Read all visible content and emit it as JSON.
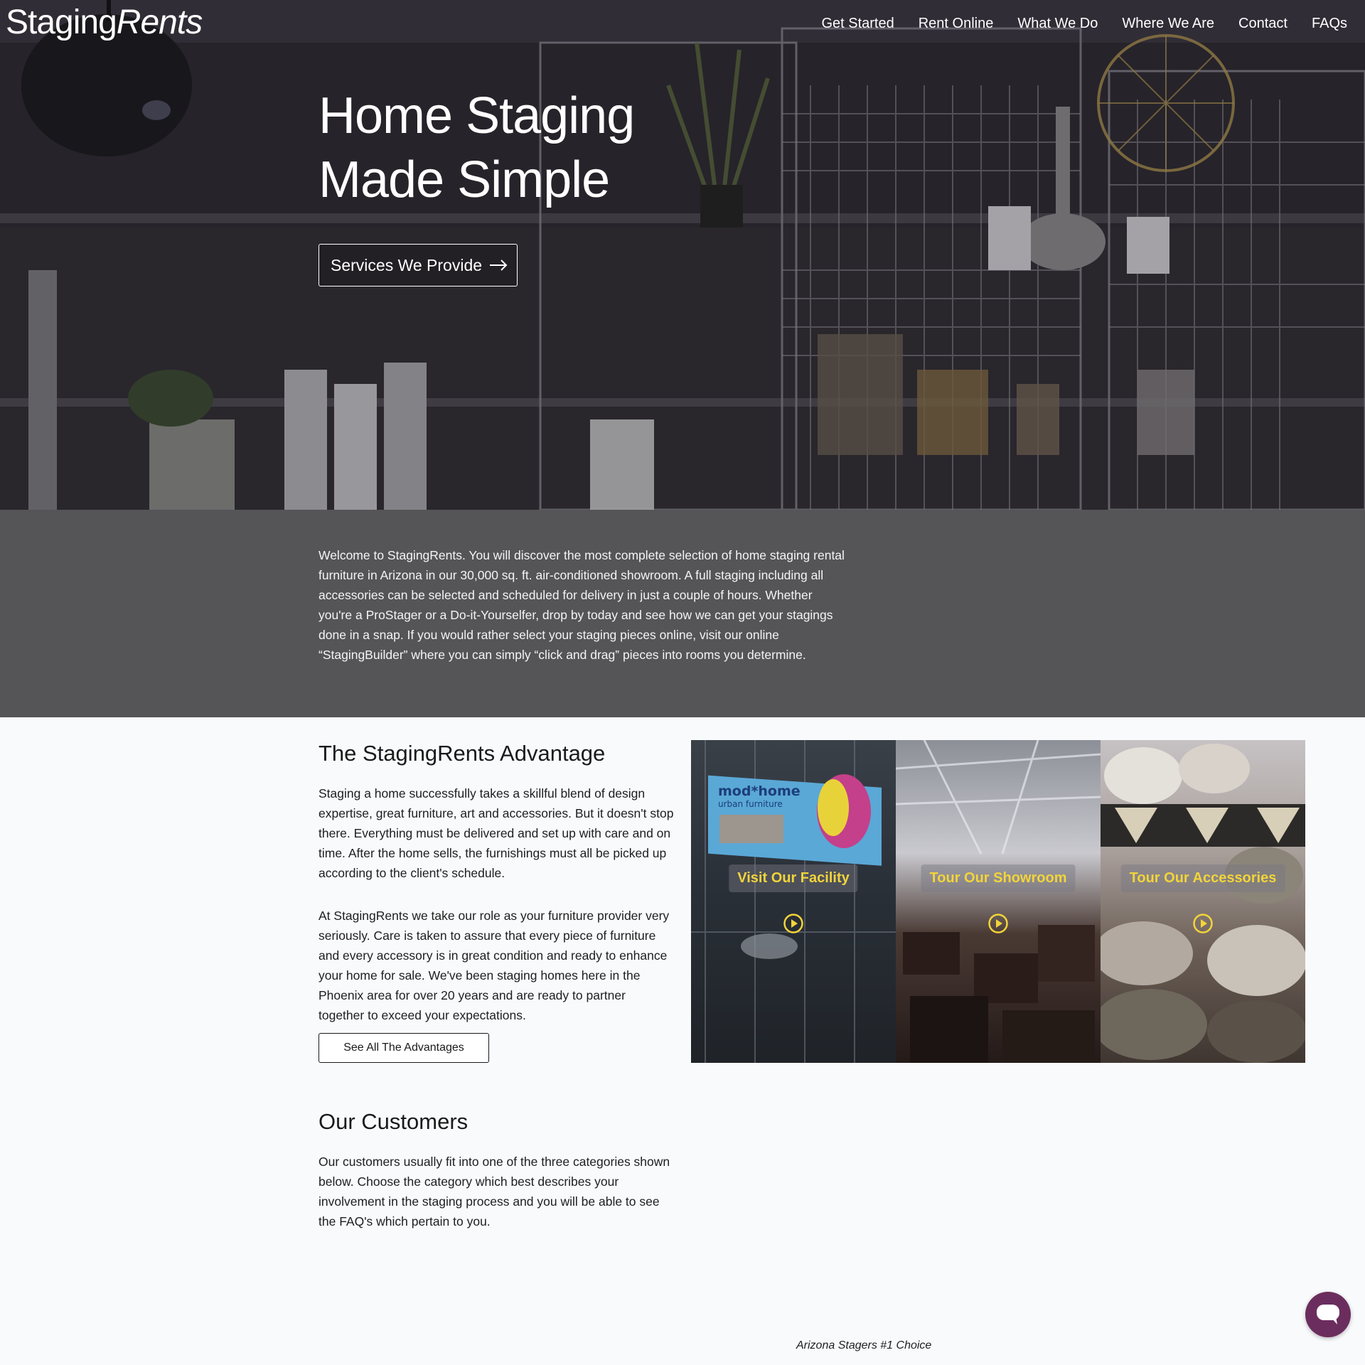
{
  "brand": {
    "logo_part1": "Staging",
    "logo_part2": "Rents"
  },
  "nav": {
    "items": [
      "Get Started",
      "Rent Online",
      "What We Do",
      "Where We Are",
      "Contact",
      "FAQs"
    ]
  },
  "hero": {
    "title_line1": "Home Staging",
    "title_line2": "Made Simple",
    "cta_label": "Services We Provide",
    "cta_icon": "arrow-right-icon"
  },
  "intro": {
    "text": "Welcome to StagingRents. You will discover the most complete selection of home staging rental furniture in Arizona in our 30,000 sq. ft. air-conditioned showroom. A full staging including all accessories can be selected and scheduled for delivery in just a couple of hours. Whether you're a ProStager or a Do-it-Yourselfer, drop by today and see how we can get your stagings done in a snap. If you would rather select your staging pieces online, visit our online “StagingBuilder” where you can simply “click and drag” pieces into rooms you determine."
  },
  "advantage": {
    "title": "The StagingRents Advantage",
    "p1": "Staging a home successfully takes a skillful blend of design expertise, great furniture, art and accessories. But it doesn't stop there. Everything must be delivered and set up with care and on time. After the home sells, the furnishings must all be picked up according to the client's schedule.",
    "p2": "At StagingRents we take our role as your furniture provider very seriously. Care is taken to assure that every piece of furniture and every accessory is in great condition and ready to enhance your home for sale. We've been staging homes here in the Phoenix area for over 20 years and are ready to partner together to exceed your expectations.",
    "button_label": "See All The Advantages"
  },
  "tiles": [
    {
      "label": "Visit Our Facility",
      "icon": "play-icon",
      "sign_line1": "mod*home",
      "sign_line2": "urban furniture"
    },
    {
      "label": "Tour Our Showroom",
      "icon": "play-icon"
    },
    {
      "label": "Tour Our Accessories",
      "icon": "play-icon"
    }
  ],
  "customers": {
    "title": "Our Customers",
    "text": "Our customers usually fit into one of the three categories shown below. Choose the category which best describes your involvement in the staging process and you will be able to see the FAQ's which pertain to you."
  },
  "caption": "Arizona Stagers #1 Choice",
  "chat": {
    "icon": "chat-icon"
  },
  "colors": {
    "accent_yellow": "#f2d43a",
    "chat_purple": "#6b2d5e",
    "intro_band": "#555558"
  }
}
